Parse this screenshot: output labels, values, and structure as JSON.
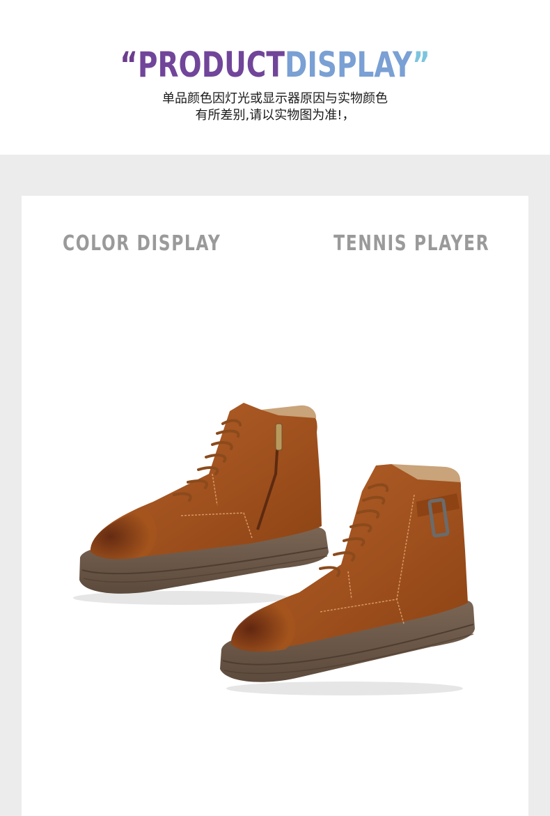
{
  "header": {
    "headline": {
      "open_quote": "“",
      "word1": "PRODUCT",
      "space": " ",
      "word2": "DISPLAY",
      "close_quote": "”"
    },
    "subtitle_line1": "单品颜色因灯光或显示器原因与实物颜色",
    "subtitle_line2": "有所差别,请以实物图为准!，"
  },
  "card": {
    "label_left": "COLOR DISPLAY",
    "label_right": "TENNIS PLAYER"
  },
  "colors": {
    "headline_start": "#6c3d8f",
    "headline_mid": "#8d7ec4",
    "headline_end": "#7cc4df",
    "panel_background": "#ececec",
    "label_gray": "#9a9a9a",
    "boot_leather": "#a4541c",
    "boot_sole": "#6d5a4a"
  },
  "image": {
    "subject": "pair of brown suede lace-up ankle boots with zipper and buckle"
  }
}
